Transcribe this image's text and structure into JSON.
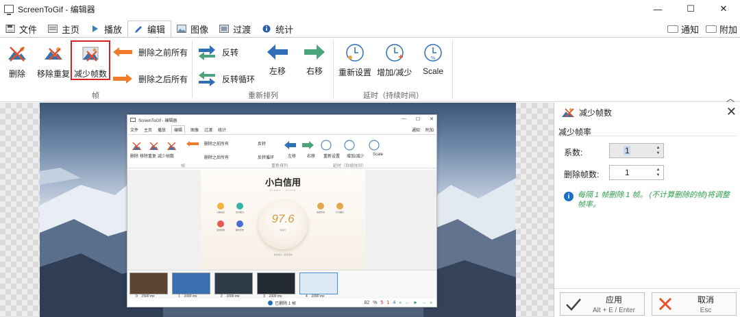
{
  "window": {
    "title": "ScreenToGif - 编辑器",
    "minimize": "—",
    "maximize": "☐",
    "close": "✕"
  },
  "tabs": [
    {
      "label": "文件",
      "icon": "save-icon"
    },
    {
      "label": "主页",
      "icon": "home-icon"
    },
    {
      "label": "播放",
      "icon": "play-icon"
    },
    {
      "label": "编辑",
      "icon": "pencil-icon",
      "active": true
    },
    {
      "label": "图像",
      "icon": "image-icon"
    },
    {
      "label": "过渡",
      "icon": "transition-icon"
    },
    {
      "label": "统计",
      "icon": "info-icon"
    }
  ],
  "tabs_right": {
    "notify": "通知",
    "extras": "附加"
  },
  "ribbon": {
    "frames": {
      "delete": "删除",
      "remove_duplicates": "移除重复",
      "reduce_frames": "减少帧数",
      "delete_before": "删除之前所有",
      "delete_after": "删除之后所有",
      "group": "帧"
    },
    "reorder": {
      "reverse": "反转",
      "yoyo": "反转循环",
      "move_left": "左移",
      "move_right": "右移",
      "group": "重新排列"
    },
    "delay": {
      "override": "重新设置",
      "increase_decrease": "增加/减少",
      "scale": "Scale",
      "group": "延时（持续时间）"
    }
  },
  "inner": {
    "title": "ScreenToGif - 编辑器",
    "tabs": [
      "文件",
      "主页",
      "播放",
      "编辑",
      "图像",
      "过渡",
      "统计"
    ],
    "tabs_right": [
      "通知",
      "附加"
    ],
    "ribbon_labels": [
      "删除",
      "移除重复",
      "减少帧数",
      "删除之前所有",
      "删除之后所有",
      "反转",
      "反转循环",
      "左移",
      "右移",
      "重新设置",
      "增加/减少",
      "Scale"
    ],
    "group_labels": [
      "帧",
      "重新排列",
      "延时（持续时间）"
    ],
    "card_title": "小白信用",
    "card_subtitle": "Credit · Score",
    "score": "97.6",
    "score_label": "信用分",
    "score_sub": "信用良好，继续保持",
    "features": [
      "人脉关系",
      "支付能力",
      "身份特质",
      "履约历史",
      "信用历史",
      "行为偏好"
    ],
    "frames": [
      {
        "index": "0",
        "delay": "1500 ms"
      },
      {
        "index": "1",
        "delay": "1000 ms"
      },
      {
        "index": "2",
        "delay": "1000 ms"
      },
      {
        "index": "3",
        "delay": "1000 ms"
      },
      {
        "index": "4",
        "delay": "1000 ms"
      }
    ],
    "status": "已删除 1 帧",
    "zoom": "82",
    "zoom_unit": "%",
    "frame_count": "5",
    "current_frame": "1",
    "current_index": "4"
  },
  "panel": {
    "title": "减少帧数",
    "section": "减少帧率",
    "factor_label": "系数:",
    "factor_value": "1",
    "remove_label": "删除帧数:",
    "remove_value": "1",
    "info": "每隔 1 帧删除 1 帧。 (不计算删除的帧)将调整帧率。",
    "apply": {
      "label": "应用",
      "shortcut": "Alt + E / Enter"
    },
    "cancel": {
      "label": "取消",
      "shortcut": "Esc"
    }
  },
  "colors": {
    "accent": "#1a6fc4",
    "selection": "#d42020",
    "info_text": "#2e9e4a",
    "orange_arrow": "#f07b2a",
    "blue_arrow": "#2f6fb5",
    "green_arrow": "#4aa37a"
  }
}
